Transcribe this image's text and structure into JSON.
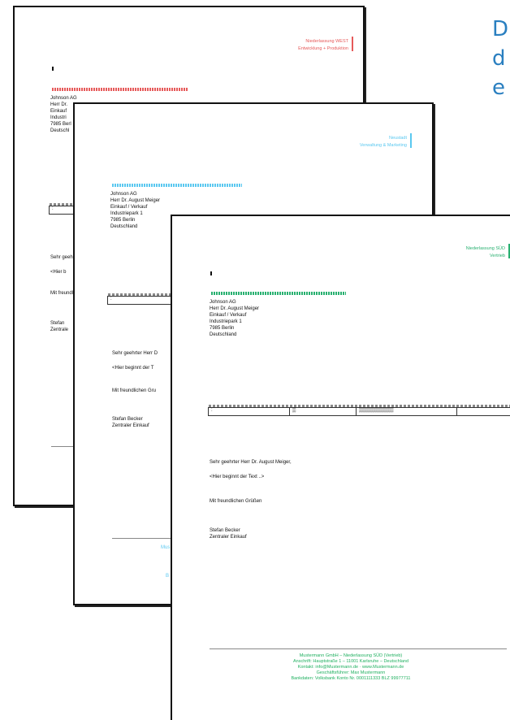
{
  "side_text": {
    "lines": [
      "D",
      "d",
      "e"
    ]
  },
  "pages": [
    {
      "branch_line1": "Niederlassung WEST",
      "branch_line2": "Entwicklung + Produktion",
      "accent": "#e65a5a",
      "address": [
        "Johnson AG",
        "Herr Dr.",
        "Einkauf",
        "Industri",
        "7985 Berl",
        "Deutschl"
      ],
      "greeting": "Sehr geehrt",
      "placeholder": "<Hier b",
      "closing": "Mit freundl",
      "sign1": "Stefan",
      "sign2": "Zentrale"
    },
    {
      "branch_line1": "Neustadt",
      "branch_line2": "Verwaltung & Marketing",
      "accent": "#5ac8f0",
      "address": [
        "Johnson AG",
        "Herr Dr. August Meiger",
        "Einkauf / Verkauf",
        "Industriepark 1",
        "7985 Berlin",
        "Deutschland"
      ],
      "greeting": "Sehr geehrter Herr D",
      "placeholder": "<Hier beginnt der T",
      "closing": "Mit freundlichen Gru",
      "sign1": "Stefan Becker",
      "sign2": "Zentraler Einkauf",
      "footer_frag1": "Mus",
      "footer_frag2": "B"
    },
    {
      "branch_line1": "Niederlassung SÜD",
      "branch_line2": "Vertrieb",
      "accent": "#28b070",
      "address": [
        "Johnson AG",
        "Herr Dr. August Meiger",
        "Einkauf / Verkauf",
        "Industriepark 1",
        "7985 Berlin",
        "Deutschland"
      ],
      "greeting": "Sehr geehrter Herr Dr. August Meiger,",
      "placeholder": "<Hier beginnt der Text ..>",
      "closing": "Mit freundlichen Grüßen",
      "sign1": "Stefan Becker",
      "sign2": "Zentraler Einkauf",
      "footer": [
        "Mustermann GmbH – Niederlassung SÜD (Vertrieb)",
        "Anschrift: Hauptstraße 1 – 11001 Karlsruhe – Deutschland",
        "Kontakt: info@Mustermann.de · www.Mustermann.de",
        "Geschäftsführer: Max Mustermann",
        "Bankdaten: Volksbank Konto Nr. 0001111333 BLZ 99977711"
      ]
    }
  ]
}
